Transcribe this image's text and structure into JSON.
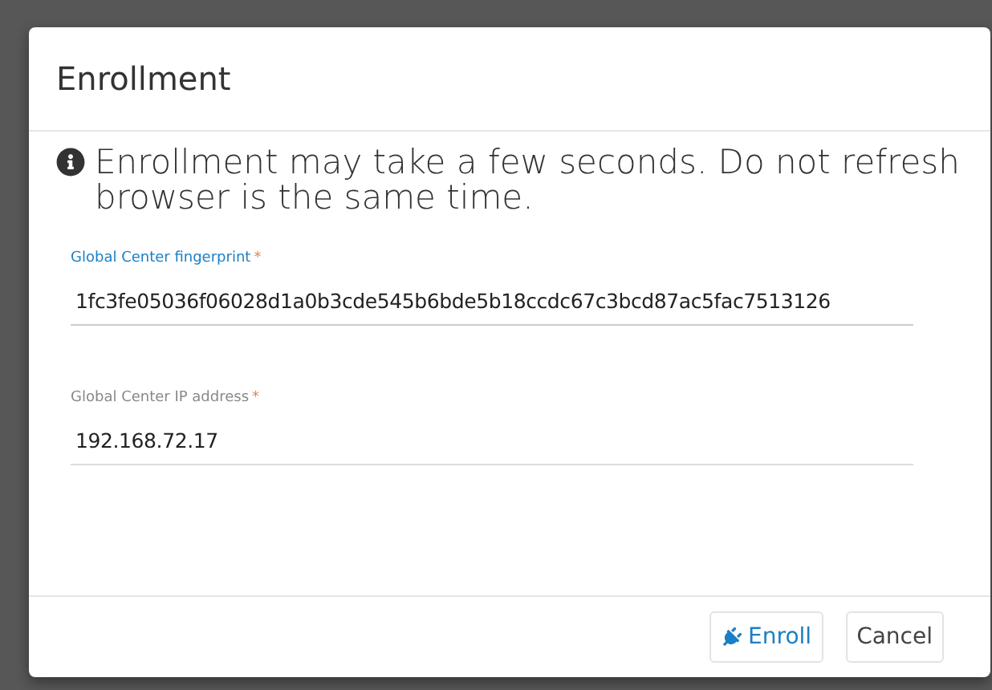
{
  "dialog": {
    "title": "Enrollment",
    "notice": "Enrollment may take a few seconds. Do not refresh browser is the same time.",
    "fields": [
      {
        "label": "Global Center fingerprint",
        "required_mark": "*",
        "value": "1fc3fe05036f06028d1a0b3cde545b6bde5b18ccdc67c3bcd87ac5fac7513126",
        "focused": true
      },
      {
        "label": "Global Center IP address",
        "required_mark": "*",
        "value": "192.168.72.17",
        "focused": false
      }
    ],
    "buttons": [
      {
        "label": "Enroll",
        "kind": "primary"
      },
      {
        "label": "Cancel",
        "kind": "secondary"
      }
    ]
  }
}
